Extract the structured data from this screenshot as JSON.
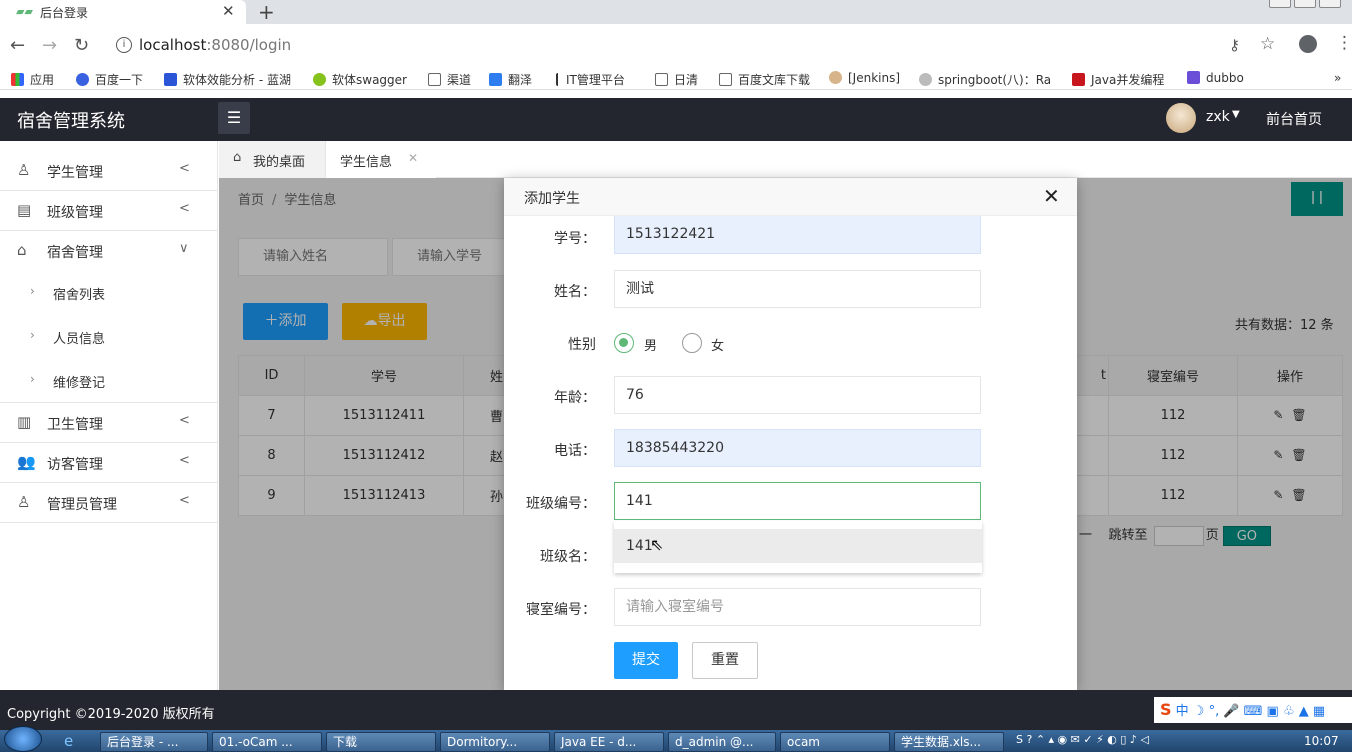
{
  "browser": {
    "tab_title": "后台登录",
    "url_host": "localhost",
    "url_rest": ":8080/login",
    "bookmarks": [
      "应用",
      "百度一下",
      "软体效能分析 - 蓝湖",
      "软体swagger",
      "渠道",
      "翻泽",
      "IT管理平台",
      "日清",
      "百度文库下载",
      "[Jenkins]",
      "springboot(八)：Ra",
      "Java并发编程",
      "dubbo"
    ]
  },
  "app": {
    "title": "宿舍管理系统",
    "user": "zxk",
    "front_link": "前台首页"
  },
  "sidebar": {
    "items": [
      {
        "label": "学生管理",
        "icon": "user-icon",
        "expanded": false
      },
      {
        "label": "班级管理",
        "icon": "doc-icon",
        "expanded": false
      },
      {
        "label": "宿舍管理",
        "icon": "building-icon",
        "expanded": true
      },
      {
        "label": "卫生管理",
        "icon": "clipboard-icon",
        "expanded": false
      },
      {
        "label": "访客管理",
        "icon": "users-icon",
        "expanded": false
      },
      {
        "label": "管理员管理",
        "icon": "admin-icon",
        "expanded": false
      }
    ],
    "subitems": [
      "宿舍列表",
      "人员信息",
      "维修登记"
    ]
  },
  "tabs": {
    "desk": "我的桌面",
    "student": "学生信息"
  },
  "breadcrumb": {
    "home": "首页",
    "current": "学生信息"
  },
  "search": {
    "name_placeholder": "请输入姓名",
    "no_placeholder": "请输入学号"
  },
  "toolbar": {
    "add": "添加",
    "export": "导出",
    "total": "共有数据：12 条"
  },
  "table": {
    "headers": {
      "id": "ID",
      "student_no": "学号",
      "name_partial": "姓",
      "extra_partial": "t",
      "dorm_no": "寝室编号",
      "ops": "操作"
    },
    "rows": [
      {
        "id": "7",
        "student_no": "1513112411",
        "name_partial": "曹",
        "dorm_no": "112"
      },
      {
        "id": "8",
        "student_no": "1513112412",
        "name_partial": "赵",
        "dorm_no": "112"
      },
      {
        "id": "9",
        "student_no": "1513112413",
        "name_partial": "孙",
        "dorm_no": "112"
      }
    ]
  },
  "pager": {
    "jump_to": "跳转至",
    "page": "页",
    "go": "GO",
    "dash": "一"
  },
  "modal": {
    "title": "添加学生",
    "fields": {
      "student_no": {
        "label": "学号：",
        "value": "1513122421"
      },
      "name": {
        "label": "姓名：",
        "value": "测试"
      },
      "sex": {
        "label": "性别",
        "male": "男",
        "female": "女",
        "selected": "男"
      },
      "age": {
        "label": "年龄：",
        "value": "76"
      },
      "phone": {
        "label": "电话：",
        "value": "18385443220"
      },
      "class_no": {
        "label": "班级编号：",
        "value": "141"
      },
      "class_name": {
        "label": "班级名："
      },
      "dorm_no": {
        "label": "寝室编号：",
        "placeholder": "请输入寝室编号"
      }
    },
    "suggestion": "141",
    "submit": "提交",
    "reset": "重置"
  },
  "footer": {
    "copyright": "Copyright ©2019-2020 版权所有"
  },
  "taskbar": {
    "items": [
      "后台登录 - ...",
      "01.-oCam ...",
      "下载",
      "Dormitory...",
      "Java EE - d...",
      "d_admin @...",
      "ocam",
      "学生数据.xls..."
    ],
    "clock": "10:07"
  },
  "colors": {
    "header": "#23262e",
    "primary": "#1e9fff",
    "warm": "#ffb800",
    "teal": "#009688",
    "radio": "#5fb878"
  }
}
